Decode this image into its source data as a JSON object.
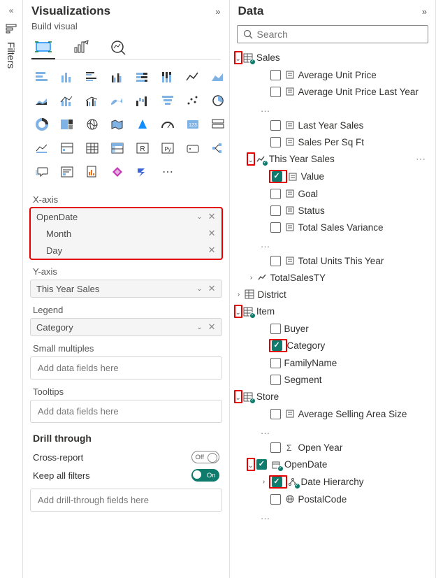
{
  "filters_rail": {
    "label": "Filters"
  },
  "viz": {
    "title": "Visualizations",
    "build_label": "Build visual",
    "wells": {
      "xaxis": {
        "label": "X-axis",
        "field": "OpenDate",
        "children": [
          "Month",
          "Day"
        ]
      },
      "yaxis": {
        "label": "Y-axis",
        "field": "This Year Sales"
      },
      "legend": {
        "label": "Legend",
        "field": "Category"
      },
      "small_multiples": {
        "label": "Small multiples",
        "placeholder": "Add data fields here"
      },
      "tooltips": {
        "label": "Tooltips",
        "placeholder": "Add data fields here"
      }
    },
    "drill": {
      "heading": "Drill through",
      "cross_report": {
        "label": "Cross-report",
        "state": "Off"
      },
      "keep_all": {
        "label": "Keep all filters",
        "state": "On"
      },
      "placeholder": "Add drill-through fields here"
    }
  },
  "data": {
    "title": "Data",
    "search_placeholder": "Search",
    "tables": {
      "sales": {
        "name": "Sales",
        "fields": {
          "avg_unit_price": "Average Unit Price",
          "avg_unit_price_ly": "Average Unit Price Last Year",
          "last_year_sales": "Last Year Sales",
          "sales_per_sqft": "Sales Per Sq Ft",
          "this_year_sales": {
            "name": "This Year Sales",
            "value": "Value",
            "goal": "Goal",
            "status": "Status"
          },
          "total_sales_variance": "Total Sales Variance",
          "total_units_ty": "Total Units This Year",
          "total_sales_ty": "TotalSalesTY"
        }
      },
      "district": {
        "name": "District"
      },
      "item": {
        "name": "Item",
        "fields": {
          "buyer": "Buyer",
          "category": "Category",
          "familyname": "FamilyName",
          "segment": "Segment"
        }
      },
      "store": {
        "name": "Store",
        "fields": {
          "avg_selling_area": "Average Selling Area Size",
          "open_year": "Open Year",
          "opendate": {
            "name": "OpenDate",
            "hierarchy": "Date Hierarchy"
          },
          "postalcode": "PostalCode"
        }
      }
    }
  }
}
